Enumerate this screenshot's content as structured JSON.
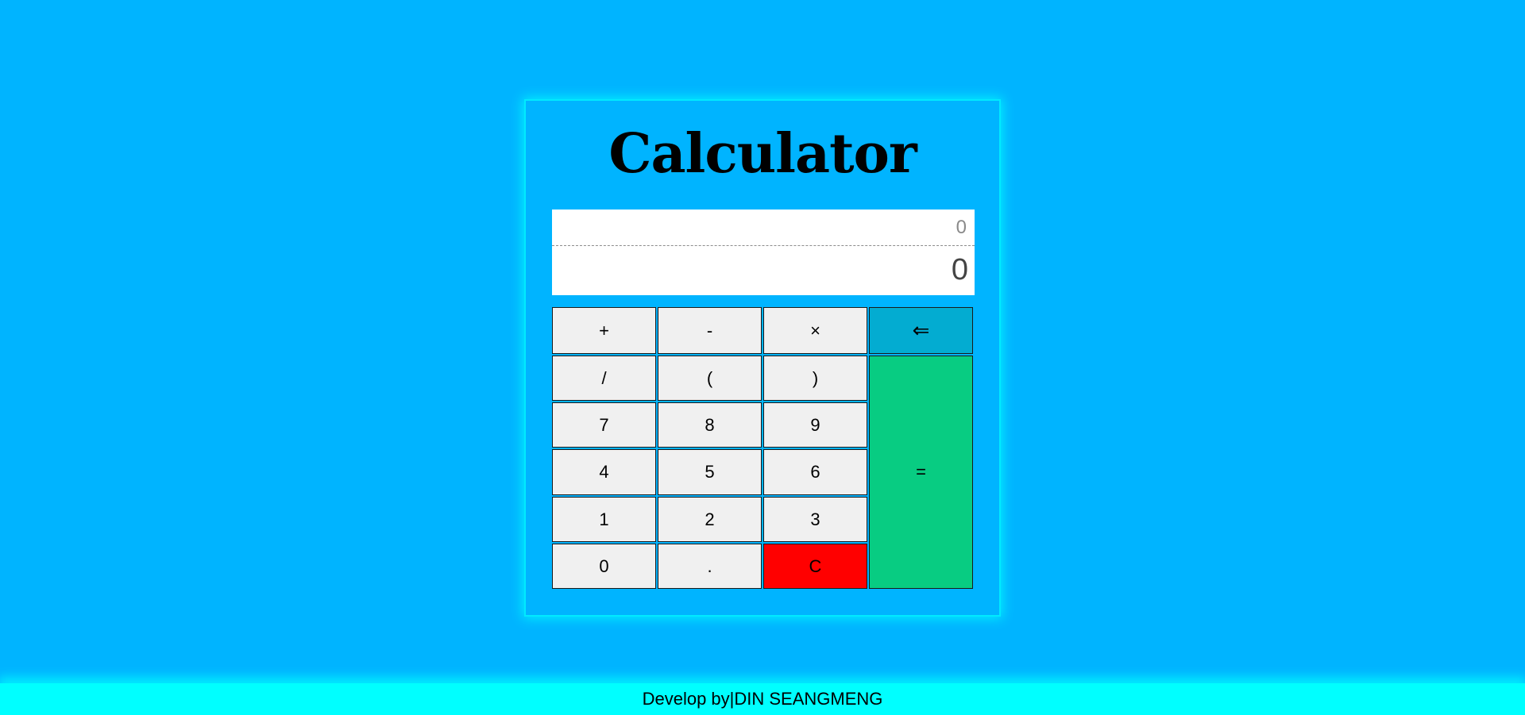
{
  "app": {
    "title": "Calculator"
  },
  "display": {
    "expression": "0",
    "result": "0"
  },
  "keys": {
    "plus": "+",
    "minus": "-",
    "multiply": "×",
    "backspace": "⇐",
    "divide": "/",
    "open_paren": "(",
    "close_paren": ")",
    "seven": "7",
    "eight": "8",
    "nine": "9",
    "four": "4",
    "five": "5",
    "six": "6",
    "one": "1",
    "two": "2",
    "three": "3",
    "zero": "0",
    "dot": ".",
    "clear": "C",
    "equals": "="
  },
  "footer": {
    "text": "Develop by|DIN SEANGMENG"
  },
  "colors": {
    "background": "#00b4ff",
    "backspace": "#03acd1",
    "equals": "#08cc82",
    "clear": "#ff0000",
    "footer": "#00ffff"
  }
}
